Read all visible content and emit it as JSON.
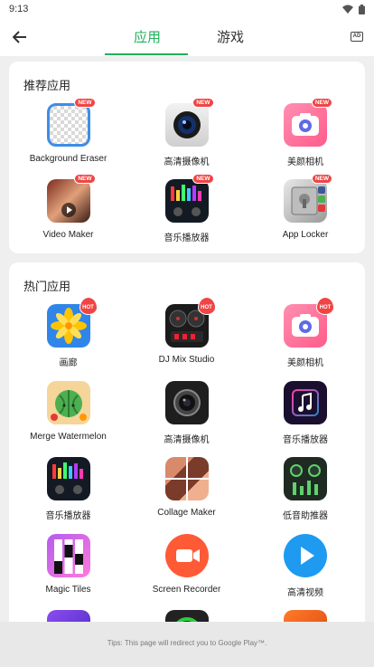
{
  "status_bar": {
    "time": "9:13",
    "icons": [
      "wifi-icon",
      "battery-icon"
    ]
  },
  "app_bar": {
    "back_icon": "arrow-left-icon",
    "tabs": [
      {
        "label": "应用",
        "active": true
      },
      {
        "label": "游戏",
        "active": false
      }
    ],
    "ad_icon": "ad-icon",
    "ad_icon_text": "AD"
  },
  "recommended": {
    "title": "推荐应用",
    "apps": [
      {
        "name": "Background Eraser",
        "badge": "NEW"
      },
      {
        "name": "高清摄像机",
        "badge": "NEW"
      },
      {
        "name": "美颜相机",
        "badge": "NEW"
      },
      {
        "name": "Video Maker",
        "badge": "NEW"
      },
      {
        "name": "音乐播放器",
        "badge": "NEW"
      },
      {
        "name": "App Locker",
        "badge": "NEW"
      }
    ]
  },
  "hot": {
    "title": "热门应用",
    "apps": [
      {
        "name": "画廊",
        "badge": "HOT"
      },
      {
        "name": "DJ Mix Studio",
        "badge": "HOT"
      },
      {
        "name": "美颜相机",
        "badge": "HOT"
      },
      {
        "name": "Merge Watermelon"
      },
      {
        "name": "高清摄像机"
      },
      {
        "name": "音乐播放器"
      },
      {
        "name": "音乐播放器"
      },
      {
        "name": "Collage Maker"
      },
      {
        "name": "低音助推器"
      },
      {
        "name": "Magic Tiles"
      },
      {
        "name": "Screen Recorder"
      },
      {
        "name": "高清视频"
      }
    ]
  },
  "tips": "Tips: This page will redirect you to Google Play™.",
  "colors": {
    "accent": "#20b15a",
    "badge": "#f04545",
    "background": "#efefef"
  }
}
